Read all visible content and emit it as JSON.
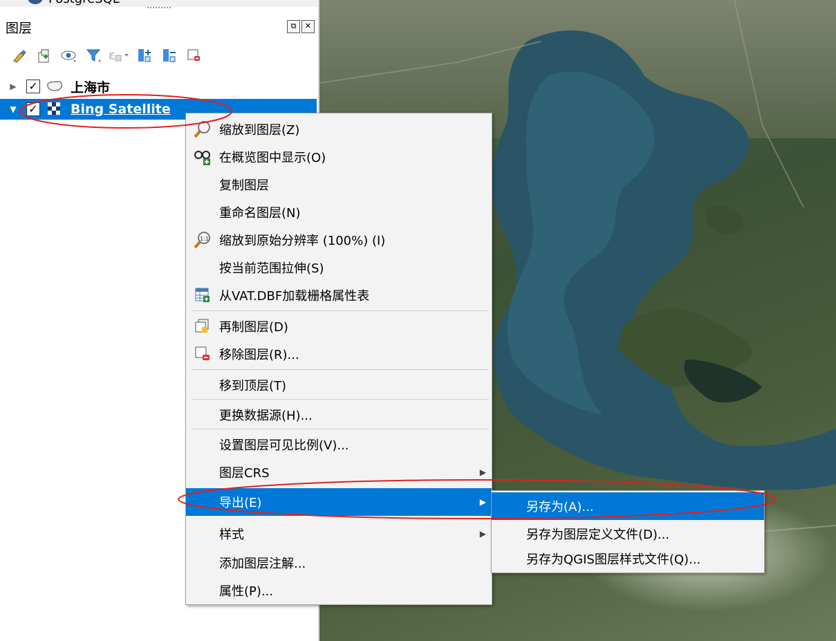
{
  "panel": {
    "top_item_label": "PostgreSQL",
    "title": "图层",
    "float_glyph": "⧉",
    "close_glyph": "✕",
    "toolbar_icons": [
      "style-manager-icon",
      "add-group-icon",
      "visibility-icon",
      "filter-legend-icon",
      "filter-expression-icon",
      "expand-all-icon",
      "collapse-all-icon",
      "remove-layer-icon"
    ]
  },
  "layers": [
    {
      "name": "上海市",
      "checked": "✓",
      "expanded": false,
      "selected": false,
      "icon": "polygon-layer-icon"
    },
    {
      "name": "Bing Satellite",
      "checked": "✓",
      "expanded": true,
      "selected": true,
      "icon": "raster-layer-icon"
    }
  ],
  "context_menu": {
    "items": [
      {
        "label": "缩放到图层(Z)",
        "icon": "zoom-to-layer-icon"
      },
      {
        "label": "在概览图中显示(O)",
        "icon": "show-in-overview-icon"
      },
      {
        "label": "复制图层",
        "icon": ""
      },
      {
        "label": "重命名图层(N)",
        "icon": ""
      },
      {
        "label": "缩放到原始分辨率 (100%) (I)",
        "icon": "zoom-native-resolution-icon"
      },
      {
        "label": "按当前范围拉伸(S)",
        "icon": ""
      },
      {
        "label": "从VAT.DBF加载栅格属性表",
        "icon": "attribute-table-icon"
      },
      {
        "label": "再制图层(D)",
        "icon": "duplicate-layer-icon"
      },
      {
        "label": "移除图层(R)...",
        "icon": "remove-layer-icon"
      },
      {
        "label": "移到顶层(T)",
        "icon": ""
      },
      {
        "label": "更换数据源(H)...",
        "icon": ""
      },
      {
        "label": "设置图层可见比例(V)...",
        "icon": ""
      },
      {
        "label": "图层CRS",
        "icon": "",
        "submenu": true
      },
      {
        "label": "导出(E)",
        "icon": "",
        "submenu": true,
        "highlighted": true
      },
      {
        "label": "样式",
        "icon": "",
        "submenu": true
      },
      {
        "label": "添加图层注解...",
        "icon": ""
      },
      {
        "label": "属性(P)...",
        "icon": ""
      }
    ]
  },
  "export_submenu": {
    "items": [
      {
        "label": "另存为(A)...",
        "highlighted": true
      },
      {
        "label": "另存为图层定义文件(D)..."
      },
      {
        "label": "另存为QGIS图层样式文件(Q)..."
      }
    ]
  },
  "colors": {
    "selection": "#0078d7",
    "annotation": "#e02020",
    "menu_bg": "#f3f3f3"
  }
}
